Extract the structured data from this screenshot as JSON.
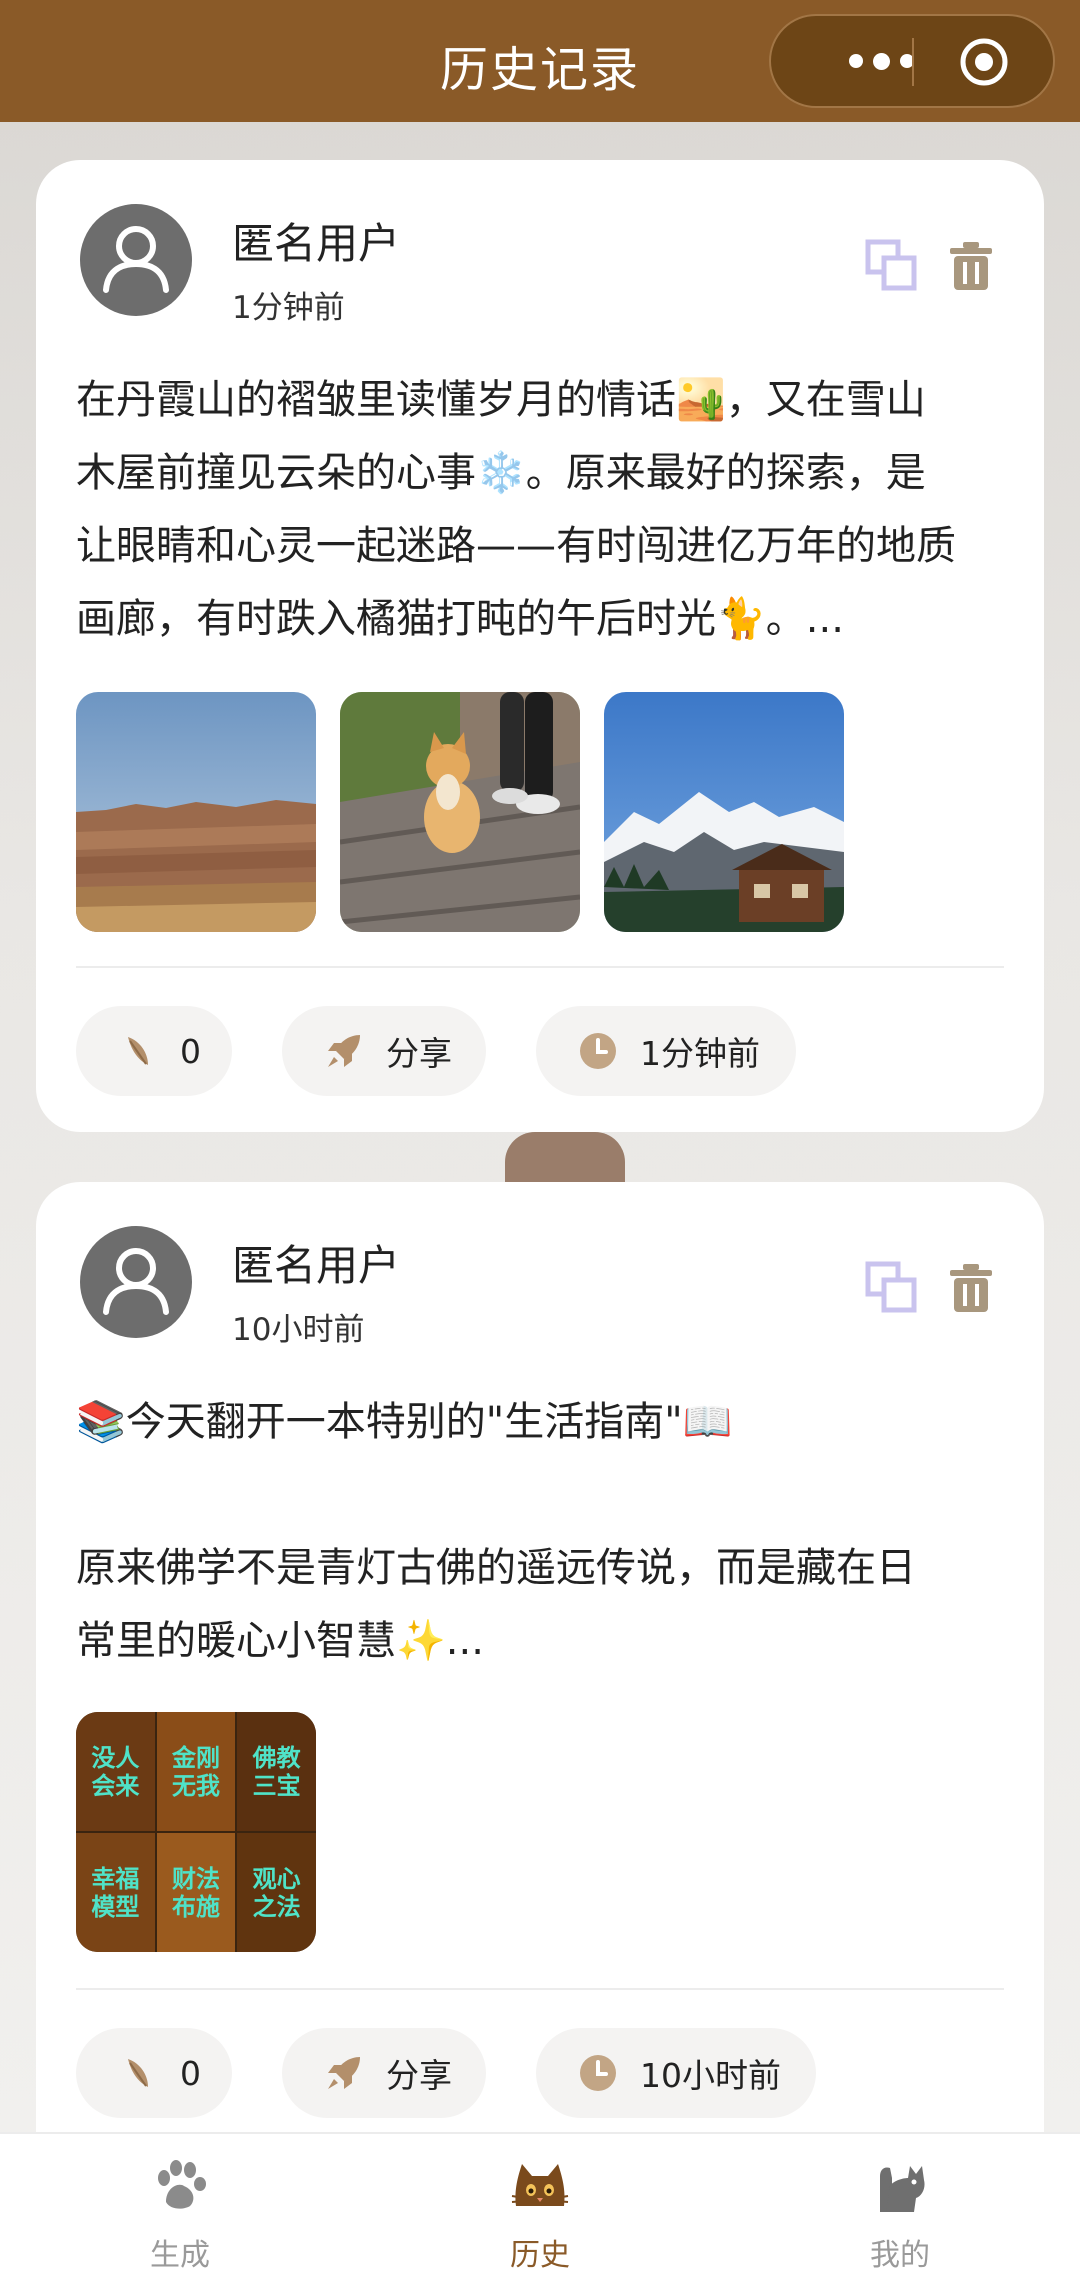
{
  "header": {
    "title": "历史记录"
  },
  "posts": [
    {
      "user": "匿名用户",
      "time": "1分钟前",
      "text_lines": [
        "在丹霞山的褶皱里读懂岁月的情话🏜️，又在雪山",
        "木屋前撞见云朵的心事❄️。原来最好的探索，是",
        "让眼睛和心灵一起迷路——有时闯进亿万年的地质",
        "画廊，有时跌入橘猫打盹的午后时光🐈。..."
      ],
      "images": [
        "danxia-landscape",
        "orange-cat-on-boardwalk",
        "snow-mountain-cabin"
      ],
      "likes": "0",
      "share_label": "分享",
      "footer_time": "1分钟前"
    },
    {
      "user": "匿名用户",
      "time": "10小时前",
      "text_lines": [
        "📚今天翻开一本特别的\"生活指南\"📖",
        "",
        "原来佛学不是青灯古佛的遥远传说，而是藏在日",
        "常里的暖心小智慧✨..."
      ],
      "images": [
        "buddhism-video-grid"
      ],
      "grid_tiles": [
        "没人会来",
        "金刚无我",
        "佛教三宝",
        "幸福模型",
        "财法布施",
        "观心之法"
      ],
      "likes": "0",
      "share_label": "分享",
      "footer_time": "10小时前"
    }
  ],
  "tabs": [
    {
      "label": "生成",
      "icon": "paw-icon",
      "active": false
    },
    {
      "label": "历史",
      "icon": "cat-face-icon",
      "active": true
    },
    {
      "label": "我的",
      "icon": "cat-silhouette-icon",
      "active": false
    }
  ],
  "colors": {
    "brand": "#8a5a28",
    "copy_icon": "#c9c3ee",
    "trash_icon": "#a8977e",
    "pill_bg": "#f4f3f2"
  }
}
